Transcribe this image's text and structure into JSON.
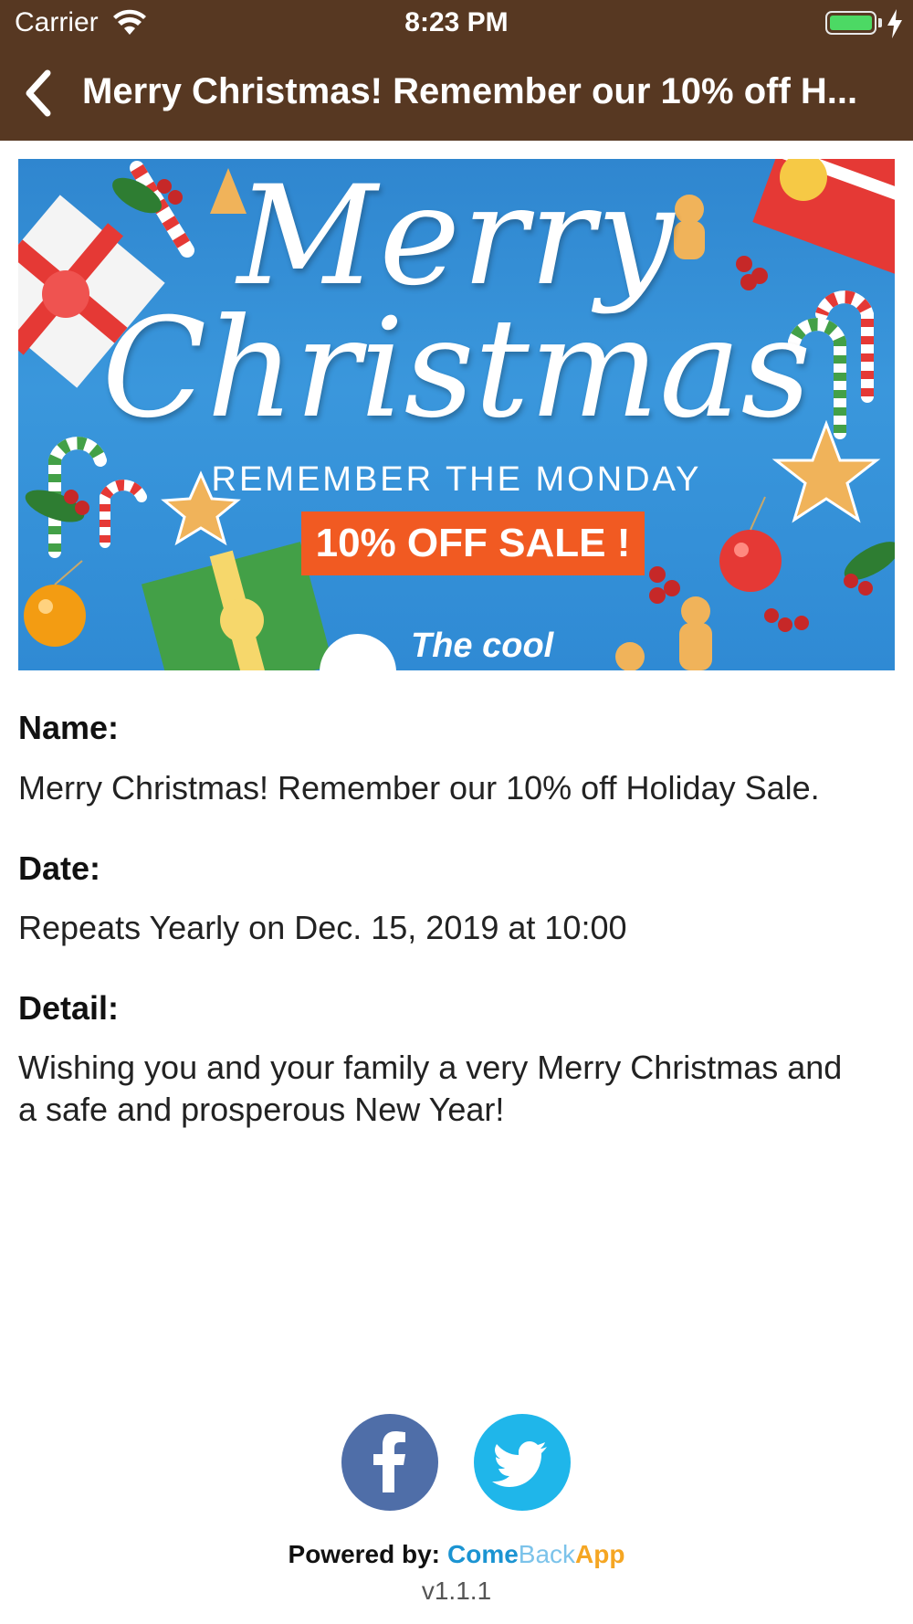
{
  "status_bar": {
    "carrier": "Carrier",
    "time": "8:23 PM",
    "wifi_icon": "wifi-icon",
    "battery_icon": "battery-charging-icon"
  },
  "nav": {
    "back_icon": "chevron-left-icon",
    "title": "Merry Christmas! Remember our 10% off H..."
  },
  "banner": {
    "line1": "Merry",
    "line2": "Christmas",
    "line3": "REMEMBER THE MONDAY",
    "sale": "10% OFF SALE !",
    "brand": "The cool"
  },
  "details": {
    "name_label": "Name:",
    "name_value": "Merry Christmas! Remember our 10% off Holiday Sale.",
    "date_label": "Date:",
    "date_value": "Repeats Yearly on Dec. 15, 2019 at 10:00",
    "detail_label": "Detail:",
    "detail_value": "Wishing you and your family a very Merry Christmas and a safe and prosperous New Year!"
  },
  "footer": {
    "facebook_icon": "facebook-icon",
    "twitter_icon": "twitter-icon",
    "powered_label": "Powered by:",
    "brand_part1": "Come",
    "brand_part2": "Back",
    "brand_part3": "App",
    "version": "v1.1.1"
  },
  "colors": {
    "nav_bg": "#573822",
    "facebook": "#4f6ea8",
    "twitter": "#1fb6ea",
    "sale_bg": "#f15a22",
    "brand_blue": "#1b94d2",
    "brand_light_blue": "#7cc3ea",
    "brand_orange": "#f5a623"
  }
}
